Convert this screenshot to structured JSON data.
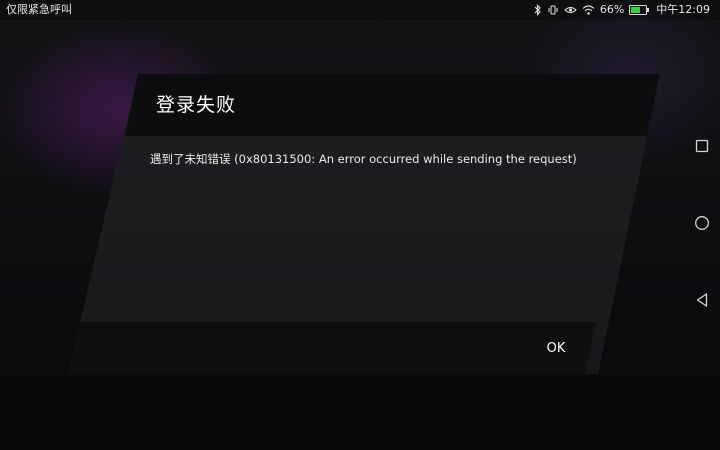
{
  "status_bar": {
    "left_text": "仅限紧急呼叫",
    "battery_percent": "66%",
    "battery_level": 0.66,
    "time": "中午12:09",
    "icons": [
      "bluetooth-icon",
      "vibrate-icon",
      "eye-comfort-icon",
      "wifi-icon",
      "battery-icon"
    ]
  },
  "dialog": {
    "title": "登录失败",
    "message": "遇到了未知错误 (0x80131500: An error occurred while sending the request)",
    "ok_label": "OK"
  },
  "nav_bar": {
    "buttons": [
      "recent-apps-icon",
      "home-icon",
      "back-icon"
    ]
  },
  "colors": {
    "battery_fill": "#36d13c",
    "dialog_bg": "#1e1e21",
    "band_bg": "#0d0d0f",
    "text": "#ffffff"
  }
}
